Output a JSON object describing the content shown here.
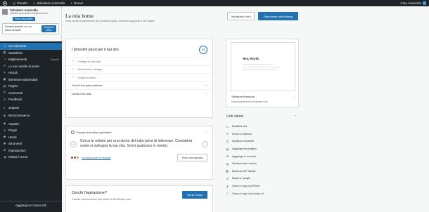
{
  "adminbar": {
    "logo": "wp-logo",
    "reader": "Reader",
    "site": "Salvatore Aranzulla",
    "new": "Nuovo",
    "user": "Ciao Aranzulla"
  },
  "sidebar": {
    "site_name": "Salvatore Aranzulla",
    "site_url": "salvatorearanzulla.wordpress.com",
    "plan_badge": "Piano disponibile",
    "domain_promo": {
      "text": "Dominio gratuito con un piano annuale",
      "button": "Scegli un piano"
    },
    "items": [
      {
        "label": "La mia home",
        "icon": "⌂",
        "active": true
      },
      {
        "label": "Statistiche",
        "icon": "▦"
      },
      {
        "label": "Miglioramenti",
        "icon": "↗",
        "badge": "Gratuito"
      },
      {
        "label": "Le tue caselle di posta",
        "icon": "✉"
      },
      {
        "label": "Articoli",
        "icon": "✎"
      },
      {
        "label": "Elementi multimediali",
        "icon": "▣"
      },
      {
        "label": "Pagine",
        "icon": "▤"
      },
      {
        "label": "Commenti",
        "icon": "✆"
      },
      {
        "label": "Feedback",
        "icon": "☰"
      },
      {
        "label": "Jetpack",
        "icon": "◐",
        "gap": true
      },
      {
        "label": "WooCommerce",
        "icon": "◈",
        "gap": true
      },
      {
        "label": "Aspetto",
        "icon": "◆",
        "gap": true
      },
      {
        "label": "Plugin",
        "icon": "⚲"
      },
      {
        "label": "Utenti",
        "icon": "◉"
      },
      {
        "label": "Strumenti",
        "icon": "✱"
      },
      {
        "label": "Impostazioni",
        "icon": "⚙"
      },
      {
        "label": "Riduci il menu",
        "icon": "◀"
      }
    ],
    "add_site": "Aggiungi un nuovo sito"
  },
  "header": {
    "title": "La mia home",
    "subtitle": "Il tuo punto di riferimento per prossimi passi, centro di supporto e link rapidi.",
    "visit_button": "Visualizza il sito",
    "hosting_button": "Rimuovere self hosting"
  },
  "steps": {
    "title": "I prossimi passi per il tuo sito",
    "progress": "3/5",
    "items": [
      {
        "label": "Configura il tuo sito",
        "done": true
      },
      {
        "label": "Seleziona un design",
        "done": true
      },
      {
        "label": "Scegli un piano",
        "done": true
      },
      {
        "label": "Scrivi il tuo primo articolo",
        "done": false
      },
      {
        "label": "Lancia il tuo sito",
        "done": false
      }
    ]
  },
  "prompts": {
    "heading": "Prompt di scrittura giornalieri",
    "text": "Cerca le notizie per una storia del tutto priva di interesse. Considera come si sviluppa la tua vita. Scrivi qualcosa in merito.",
    "see_all": "Visualizza tutte le risposte",
    "write_button": "Invia una risposta",
    "avatar_colors": [
      "#d63638",
      "#2271b1",
      "#dba617"
    ]
  },
  "inspiration": {
    "title": "Cerchi l'ispirazione?",
    "subtitle": "Guarda cosa scrivono altri utenti di WordPress.com.",
    "button": "Vai ad Scopri"
  },
  "preview": {
    "hello": "Hey, World.",
    "name": "Salvatore Aranzulla",
    "url": "salvatorearanzulla.wordpress.com"
  },
  "quick_links": {
    "title": "Link veloci",
    "items": [
      {
        "label": "Modifica sito",
        "icon": "▭"
      },
      {
        "label": "Scrivi un articolo",
        "icon": "✎"
      },
      {
        "label": "Gestisci commenti",
        "icon": "✆"
      },
      {
        "label": "Aggiungi una pagina",
        "icon": "▤"
      },
      {
        "label": "Aggiungi un dominio",
        "icon": "⊕"
      },
      {
        "label": "Gestisci tutti i domini",
        "icon": "◍"
      },
      {
        "label": "Bacheca WP Admin",
        "icon": "◧"
      },
      {
        "label": "Esplora i plugin",
        "icon": "⚲"
      },
      {
        "label": "Crea un logo con Fiverr",
        "icon": "✦"
      },
      {
        "label": "Crea un logo con Looka AI",
        "icon": "✧"
      }
    ]
  },
  "colors": {
    "accent": "#2271b1",
    "admin_dark": "#1d2327"
  }
}
